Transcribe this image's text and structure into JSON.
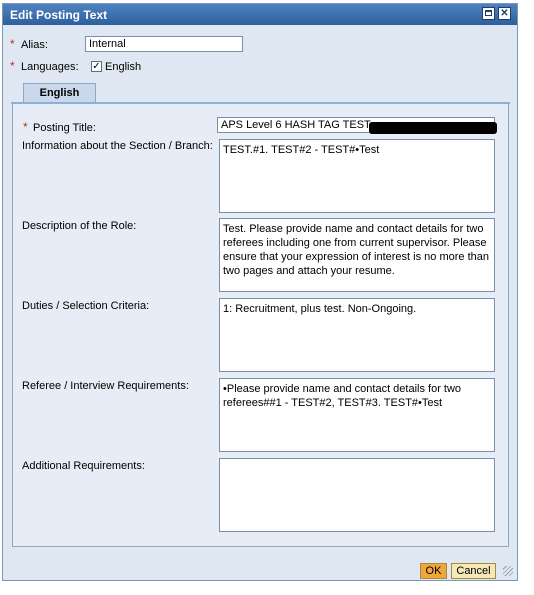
{
  "dialog": {
    "title": "Edit Posting Text",
    "maximize_icon": "maximize-icon",
    "close_icon": "close-icon",
    "close_glyph": "✕"
  },
  "form": {
    "required_marker": "*",
    "alias_label": "Alias:",
    "alias_value": "Internal",
    "languages_label": "Languages:",
    "english_checkbox_label": "English",
    "english_checked": true,
    "check_glyph": "✓"
  },
  "tab": {
    "label": "English"
  },
  "fields": {
    "posting_title_label": "Posting Title:",
    "posting_title_value": "APS Level 6 HASH TAG TEST",
    "section_label": "Information about the Section / Branch:",
    "section_value": "TEST.#1. TEST#2 - TEST#•Test",
    "role_label": "Description of the Role:",
    "role_value": "Test. Please provide name and contact details for two referees including one from current supervisor. Please ensure that your expression of interest is no more than two pages and attach your resume.",
    "duties_label": "Duties / Selection Criteria:",
    "duties_value": "1: Recruitment, plus test. Non-Ongoing.",
    "referee_label": "Referee / Interview Requirements:",
    "referee_value": "•Please provide name and contact details for two referees##1 - TEST#2, TEST#3. TEST#•Test",
    "additional_label": "Additional Requirements:",
    "additional_value": ""
  },
  "buttons": {
    "ok": "OK",
    "cancel": "Cancel"
  },
  "colors": {
    "titlebar": "#2d5f9c",
    "required": "#c8281e",
    "ok_button": "#f1a63a"
  }
}
